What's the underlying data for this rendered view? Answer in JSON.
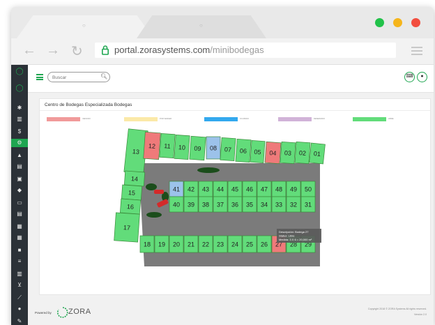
{
  "browser": {
    "tabs": [
      {
        "label": "○"
      },
      {
        "label": "○"
      }
    ],
    "window_controls": [
      {
        "name": "maximize",
        "color": "#22c24a"
      },
      {
        "name": "minimize",
        "color": "#f5b51b"
      },
      {
        "name": "close",
        "color": "#f24e3f"
      }
    ],
    "url_host": "portal.zorasystems.com",
    "url_path": "/minibodegas",
    "nav": {
      "back": "←",
      "forward": "→",
      "reload": "↻"
    }
  },
  "sidebar": {
    "items": [
      {
        "icon": "logo-ring-icon",
        "glyph": "◯"
      },
      {
        "icon": "logo-ring-icon-2",
        "glyph": "◯"
      },
      {
        "icon": "palette-icon",
        "glyph": "✱"
      },
      {
        "icon": "bar-chart-icon",
        "glyph": "▥"
      },
      {
        "icon": "dollar-icon",
        "glyph": "$"
      },
      {
        "icon": "settings-icon",
        "glyph": "⚙"
      },
      {
        "icon": "warning-icon",
        "glyph": "▲"
      },
      {
        "icon": "document-icon",
        "glyph": "▤"
      },
      {
        "icon": "document-icon-2",
        "glyph": "▣"
      },
      {
        "icon": "tag-icon",
        "glyph": "◆"
      },
      {
        "icon": "id-card-icon",
        "glyph": "▭"
      },
      {
        "icon": "file-icon",
        "glyph": "▤"
      },
      {
        "icon": "calendar-icon",
        "glyph": "▦"
      },
      {
        "icon": "calendar-icon-2",
        "glyph": "▦"
      },
      {
        "icon": "briefcase-icon",
        "glyph": "■"
      },
      {
        "icon": "list-icon",
        "glyph": "≡"
      },
      {
        "icon": "chart-icon",
        "glyph": "▥"
      },
      {
        "icon": "cart-icon",
        "glyph": "⊻"
      },
      {
        "icon": "line-chart-icon",
        "glyph": "⟋"
      },
      {
        "icon": "user-circle-icon",
        "glyph": "●"
      },
      {
        "icon": "edit-icon",
        "glyph": "✎"
      }
    ],
    "active_index": 5,
    "accent": "#1fa651"
  },
  "topbar": {
    "search_placeholder": "Buscar",
    "icons": [
      {
        "name": "chat-notification-icon",
        "glyph": "⌨"
      },
      {
        "name": "user-icon",
        "glyph": "●"
      }
    ]
  },
  "page": {
    "title": "Centro de Bodegas Especializada Bodegas",
    "legend": [
      {
        "label": "VENCIDO",
        "color": "#f19a9a"
      },
      {
        "label": "POR VENCER",
        "color": "#fbe9a8"
      },
      {
        "label": "OCUPADO",
        "color": "#33a9ee"
      },
      {
        "label": "RESERVADO",
        "color": "#d1b3d8"
      },
      {
        "label": "LIBRE",
        "color": "#62dc7a"
      }
    ],
    "colors": {
      "libre": "#62dc7a",
      "vencido": "#ef7a7a",
      "ocupado": "#9cc2ea",
      "patio": "#7b7b7b"
    },
    "units": {
      "top_row": [
        {
          "n": "13",
          "status": "libre"
        },
        {
          "n": "12",
          "status": "vencido"
        },
        {
          "n": "11",
          "status": "libre"
        },
        {
          "n": "10",
          "status": "libre"
        },
        {
          "n": "09",
          "status": "libre"
        },
        {
          "n": "08",
          "status": "ocupado"
        },
        {
          "n": "07",
          "status": "libre"
        },
        {
          "n": "06",
          "status": "libre"
        },
        {
          "n": "05",
          "status": "libre"
        },
        {
          "n": "04",
          "status": "vencido"
        },
        {
          "n": "03",
          "status": "libre"
        },
        {
          "n": "02",
          "status": "libre"
        },
        {
          "n": "01",
          "status": "libre"
        }
      ],
      "left_column": [
        {
          "n": "14",
          "status": "libre"
        },
        {
          "n": "15",
          "status": "libre"
        },
        {
          "n": "16",
          "status": "libre"
        },
        {
          "n": "17",
          "status": "libre"
        }
      ],
      "mid_top": [
        {
          "n": "41",
          "status": "ocupado"
        },
        {
          "n": "42",
          "status": "libre"
        },
        {
          "n": "43",
          "status": "libre"
        },
        {
          "n": "44",
          "status": "libre"
        },
        {
          "n": "45",
          "status": "libre"
        },
        {
          "n": "46",
          "status": "libre"
        },
        {
          "n": "47",
          "status": "libre"
        },
        {
          "n": "48",
          "status": "libre"
        },
        {
          "n": "49",
          "status": "libre"
        },
        {
          "n": "50",
          "status": "libre"
        }
      ],
      "mid_bottom": [
        {
          "n": "40",
          "status": "libre"
        },
        {
          "n": "39",
          "status": "libre"
        },
        {
          "n": "38",
          "status": "libre"
        },
        {
          "n": "37",
          "status": "libre"
        },
        {
          "n": "36",
          "status": "libre"
        },
        {
          "n": "35",
          "status": "libre"
        },
        {
          "n": "34",
          "status": "libre"
        },
        {
          "n": "33",
          "status": "libre"
        },
        {
          "n": "32",
          "status": "libre"
        },
        {
          "n": "31",
          "status": "libre"
        }
      ],
      "bottom_row": [
        {
          "n": "18",
          "status": "libre"
        },
        {
          "n": "19",
          "status": "libre"
        },
        {
          "n": "20",
          "status": "libre"
        },
        {
          "n": "21",
          "status": "libre"
        },
        {
          "n": "22",
          "status": "libre"
        },
        {
          "n": "23",
          "status": "libre"
        },
        {
          "n": "24",
          "status": "libre"
        },
        {
          "n": "25",
          "status": "libre"
        },
        {
          "n": "26",
          "status": "libre"
        },
        {
          "n": "27",
          "status": "vencido"
        },
        {
          "n": "28",
          "status": "libre"
        },
        {
          "n": "29",
          "status": "libre"
        }
      ]
    },
    "tooltip": {
      "line1": "Descripción: Bodega 27",
      "line2": "Status: Libre",
      "line3": "Medida: 3 X 6 = 20,000 m²"
    }
  },
  "footer": {
    "powered_by": "Powered by",
    "brand": "ZORA",
    "copyright": "Copyright 2018 © ZORA Systems All rights reserved.",
    "version": "Versión 2.0"
  }
}
